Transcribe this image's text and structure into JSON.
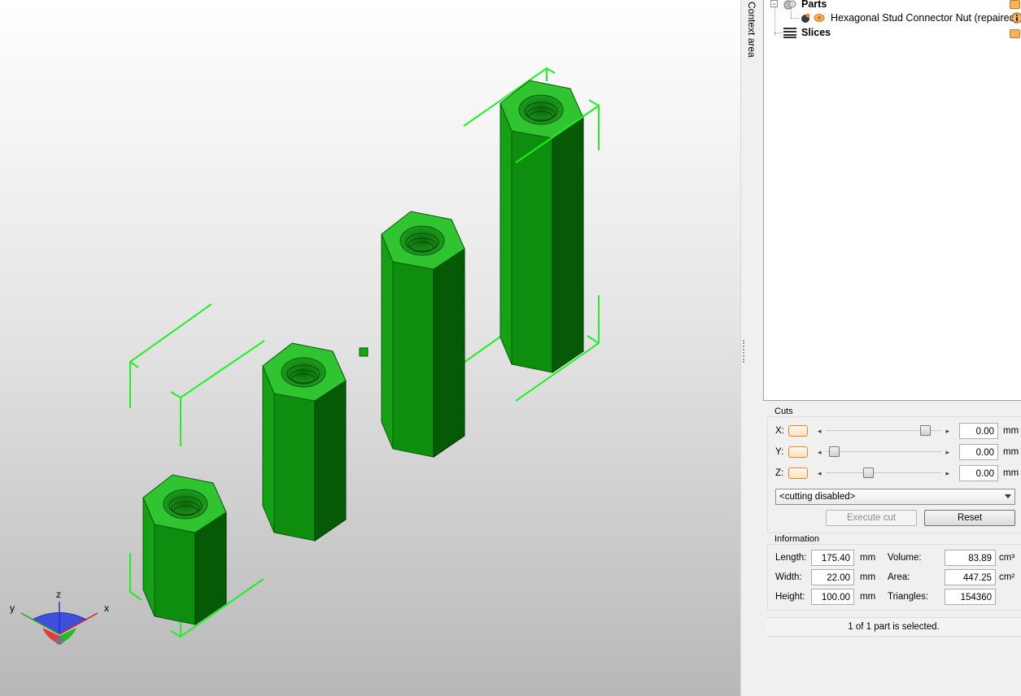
{
  "viewport": {
    "axes": {
      "x": "x",
      "y": "y",
      "z": "z"
    },
    "model_color": "#1fb41f",
    "selection_color": "#22dd22"
  },
  "context_area": {
    "label": "Context area"
  },
  "tree": {
    "parts_label": "Parts",
    "part_name": "Hexagonal Stud Connector Nut (repaired)",
    "slices_label": "Slices"
  },
  "cuts": {
    "title": "Cuts",
    "x_label": "X:",
    "y_label": "Y:",
    "z_label": "Z:",
    "x_value": "0.00",
    "y_value": "0.00",
    "z_value": "0.00",
    "unit": "mm",
    "mode": "<cutting disabled>",
    "execute_label": "Execute cut",
    "reset_label": "Reset"
  },
  "information": {
    "title": "Information",
    "length_label": "Length:",
    "length_value": "175.40",
    "width_label": "Width:",
    "width_value": "22.00",
    "height_label": "Height:",
    "height_value": "100.00",
    "volume_label": "Volume:",
    "volume_value": "83.89",
    "area_label": "Area:",
    "area_value": "447.25",
    "triangles_label": "Triangles:",
    "triangles_value": "154360",
    "mm": "mm",
    "cm3": "cm³",
    "cm2": "cm²"
  },
  "status": {
    "text": "1 of 1 part is selected."
  }
}
